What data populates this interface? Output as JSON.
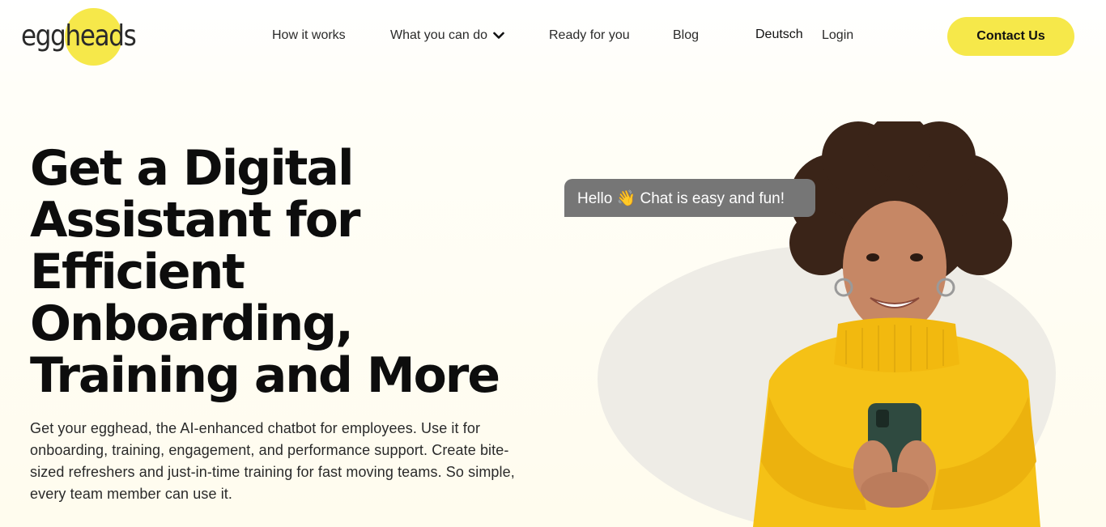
{
  "brand": {
    "name": "eggheads",
    "accent_color": "#f6e84a"
  },
  "nav": {
    "items": [
      {
        "label": "How it works"
      },
      {
        "label": "What you can do",
        "icon": "chevron-down-icon"
      },
      {
        "label": "Ready for you"
      },
      {
        "label": "Blog"
      }
    ],
    "language": "Deutsch",
    "login": "Login",
    "contact": "Contact Us"
  },
  "hero": {
    "title_lines": [
      "Get a Digital",
      "Assistant for",
      "Efficient",
      "Onboarding,",
      "Training and More"
    ],
    "description": "Get your egghead, the AI-enhanced chatbot for employees. Use it for onboarding, training, engagement, and performance support. Create bite-sized refreshers and just-in-time training for fast moving teams. So simple, every team member can use it.",
    "chat_bubble": "Hello 👋 Chat is easy and fun!"
  }
}
